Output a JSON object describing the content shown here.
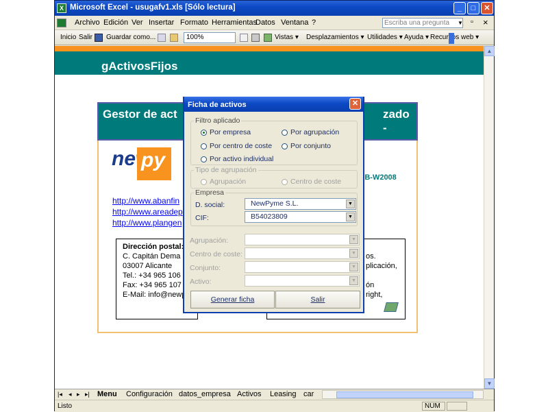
{
  "window": {
    "title": "Microsoft Excel - usugafv1.xls  [Sólo lectura]",
    "app_icon": "excel-icon",
    "minimize": "_",
    "maximize": "□",
    "close": "✕"
  },
  "menu": {
    "items": [
      "Archivo",
      "Edición",
      "Ver",
      "Insertar",
      "Formato",
      "Herramientas",
      "Datos",
      "Ventana",
      "?"
    ],
    "ask_placeholder": "Escriba una pregunta",
    "doc_min": "_",
    "doc_restore": "▫",
    "doc_close": "×"
  },
  "toolbar": {
    "inicio": "Inicio",
    "salir": "Salir",
    "guardar": "Guardar como...",
    "zoom": "100%",
    "vistas": "Vistas ▾",
    "desplazamientos": "Desplazamientos ▾",
    "utilidades": "Utilidades ▾",
    "ayuda": "Ayuda ▾",
    "recursos": "Recursos web ▾"
  },
  "sheet": {
    "header_title": "gActivosFijos",
    "card_title_left": "Gestor de act",
    "card_title_right": "zado -",
    "logo_new": "new",
    "logo_py": "py",
    "web_code": "EB-W2008",
    "links": [
      "http://www.abanfin",
      "http://www.areadep",
      "http://www.plangen"
    ],
    "address": {
      "heading": "Dirección postal:",
      "line1": "C. Capitán Dema 3",
      "line2": "03007 Alicante",
      "line3": "Tel.: +34 965 106",
      "line4": "Fax:  +34 965 107",
      "line5": "E-Mail: info@newp"
    },
    "right_text": [
      "os.",
      "plicación,",
      "ón",
      "right,"
    ]
  },
  "tabs": {
    "nav": [
      "|◂",
      "◂",
      "▸",
      "▸|"
    ],
    "sheets": [
      "Menu",
      "Configuración",
      "datos_empresa",
      "Activos",
      "Leasing",
      "car"
    ],
    "active": "Menu"
  },
  "status": {
    "left": "Listo",
    "num": "NUM"
  },
  "dialog": {
    "title": "Ficha de activos",
    "filtro": {
      "legend": "Filtro aplicado",
      "options": [
        "Por empresa",
        "Por agrupación",
        "Por centro de coste",
        "Por conjunto",
        "Por activo individual"
      ],
      "selected": "Por empresa"
    },
    "tipo": {
      "legend": "Tipo de agrupación",
      "options": [
        "Agrupación",
        "Centro de coste"
      ]
    },
    "empresa": {
      "legend": "Empresa",
      "dsocial_label": "D. social:",
      "dsocial_value": "NewPyme S.L.",
      "cif_label": "CIF:",
      "cif_value": "B54023809"
    },
    "fields": {
      "agrupacion": "Agrupación:",
      "centro": "Centro de coste:",
      "conjunto": "Conjunto:",
      "activo": "Activo:"
    },
    "buttons": {
      "generar": "Generar ficha",
      "salir": "Salir"
    }
  }
}
